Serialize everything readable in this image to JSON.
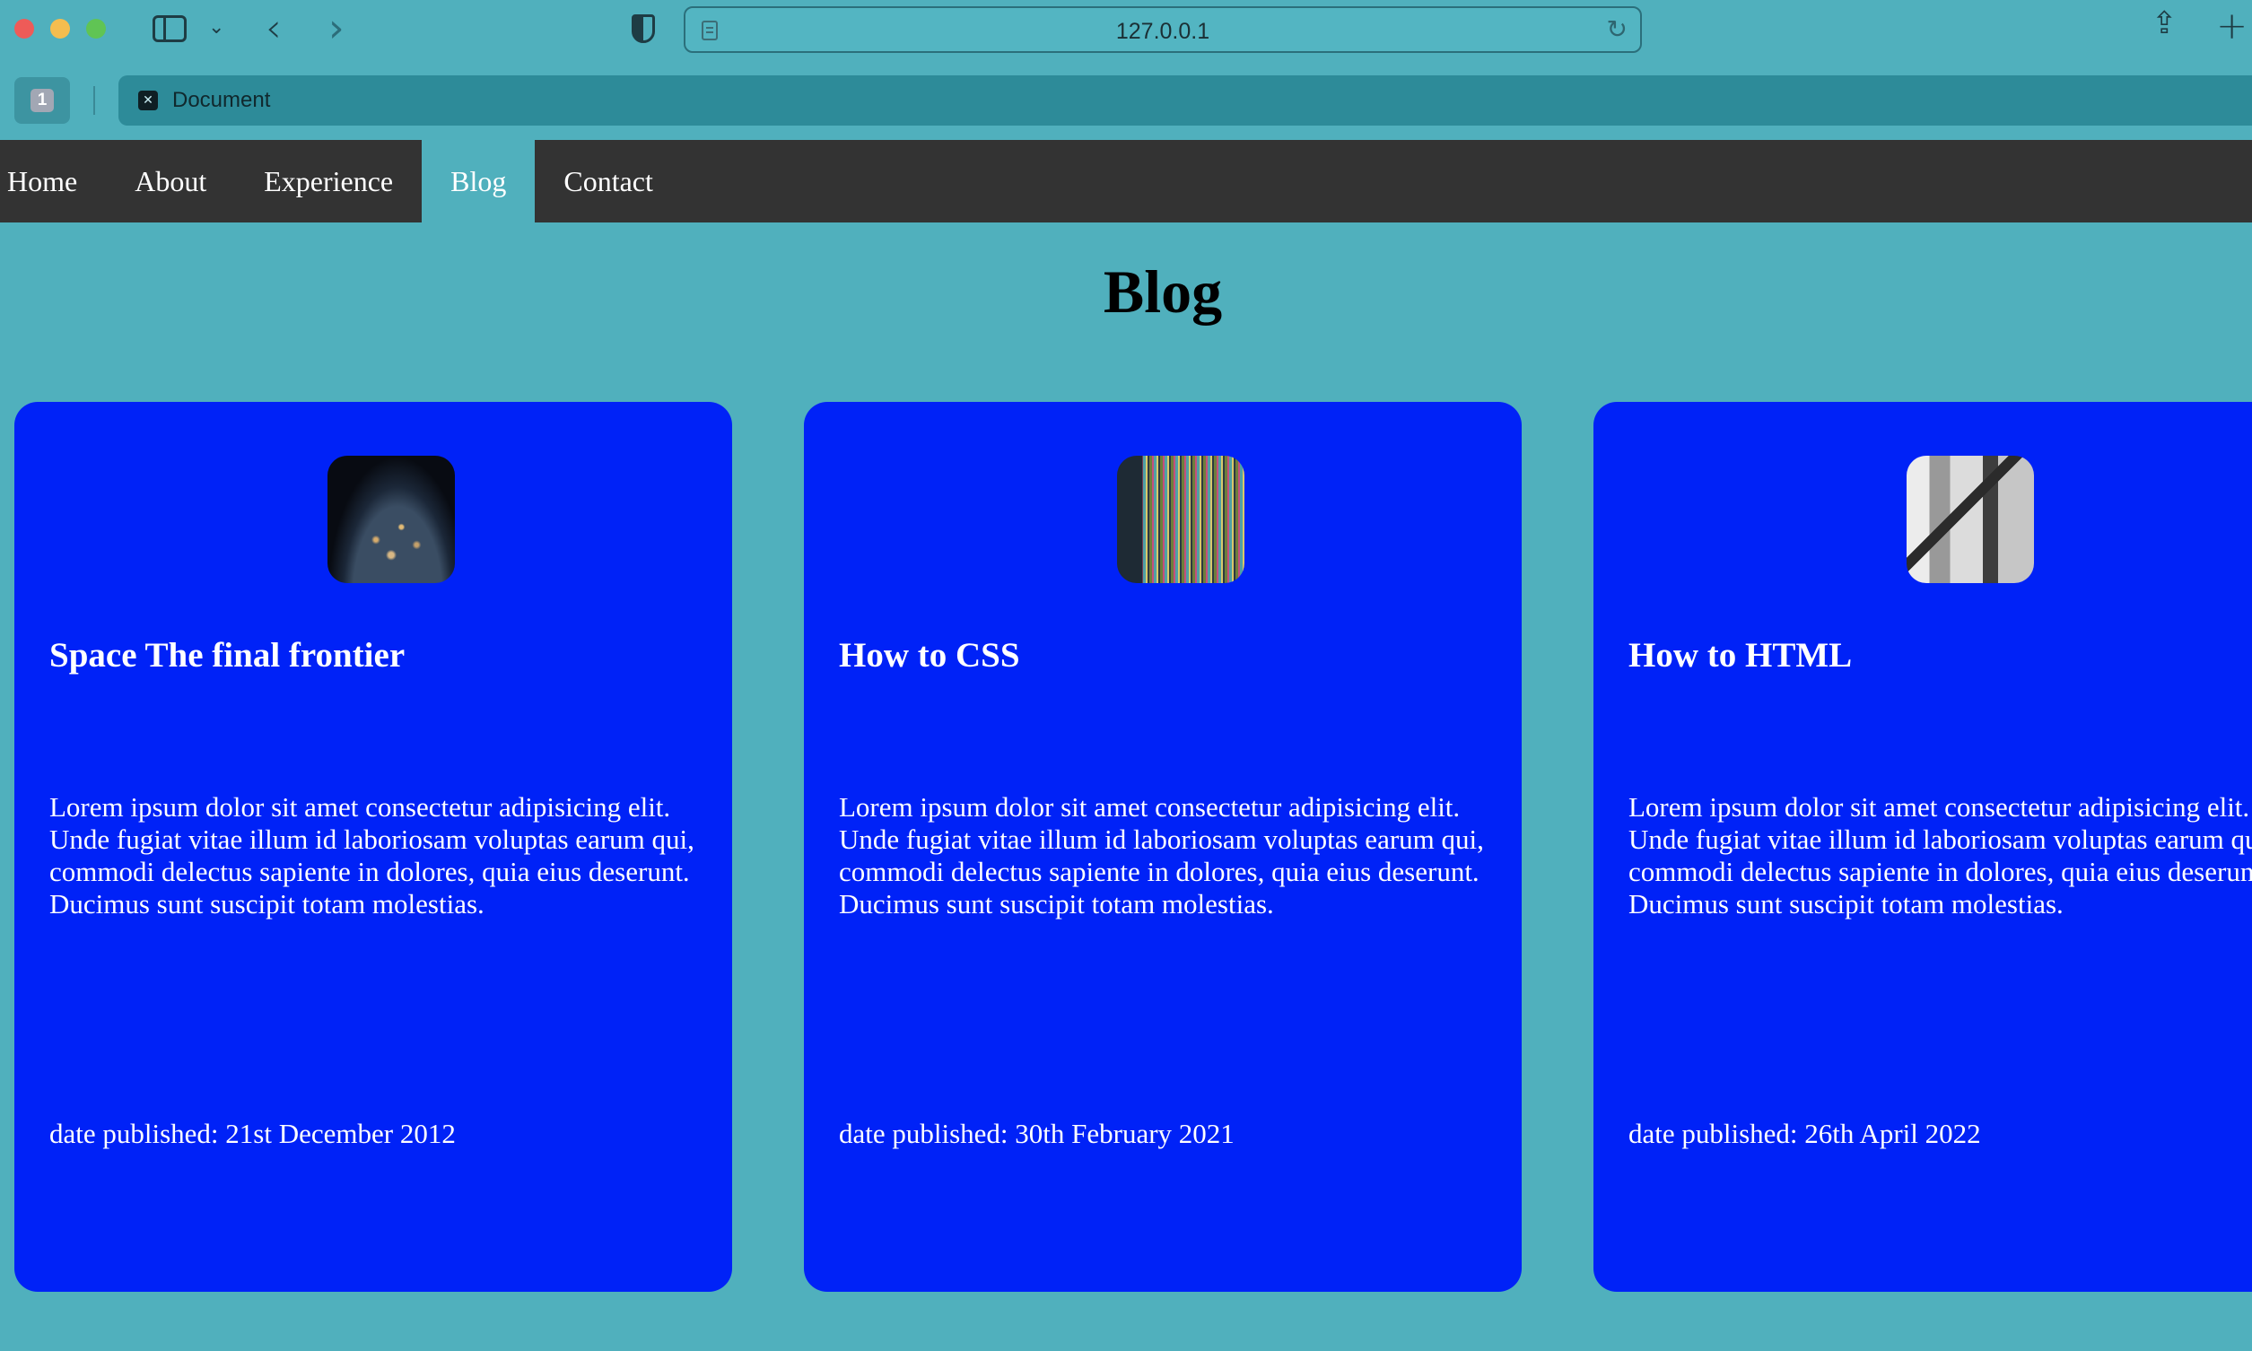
{
  "browser": {
    "url": "127.0.0.1",
    "tab_count": "1",
    "tab_title": "Document"
  },
  "nav": {
    "items": [
      {
        "label": "Home"
      },
      {
        "label": "About"
      },
      {
        "label": "Experience"
      },
      {
        "label": "Blog",
        "active": true
      },
      {
        "label": "Contact"
      }
    ]
  },
  "page": {
    "title": "Blog"
  },
  "posts": [
    {
      "title": "Space The final frontier",
      "body": "Lorem ipsum dolor sit amet consectetur adipisicing elit. Unde fugiat vitae illum id laboriosam voluptas earum qui, commodi delectus sapiente in dolores, quia eius deserunt. Ducimus sunt suscipit totam molestias.",
      "date": "date published: 21st December 2012"
    },
    {
      "title": "How to CSS",
      "body": "Lorem ipsum dolor sit amet consectetur adipisicing elit. Unde fugiat vitae illum id laboriosam voluptas earum qui, commodi delectus sapiente in dolores, quia eius deserunt. Ducimus sunt suscipit totam molestias.",
      "date": "date published: 30th February 2021"
    },
    {
      "title": "How to HTML",
      "body": "Lorem ipsum dolor sit amet consectetur adipisicing elit. Unde fugiat vitae illum id laboriosam voluptas earum qui, commodi delectus sapiente in dolores, quia eius deserunt. Ducimus sunt suscipit totam molestias.",
      "date": "date published: 26th April 2022"
    }
  ],
  "colors": {
    "page_background": "#50b0bd",
    "nav_background": "#333333",
    "card_background": "#0022f7",
    "text_light": "#ffffff"
  }
}
